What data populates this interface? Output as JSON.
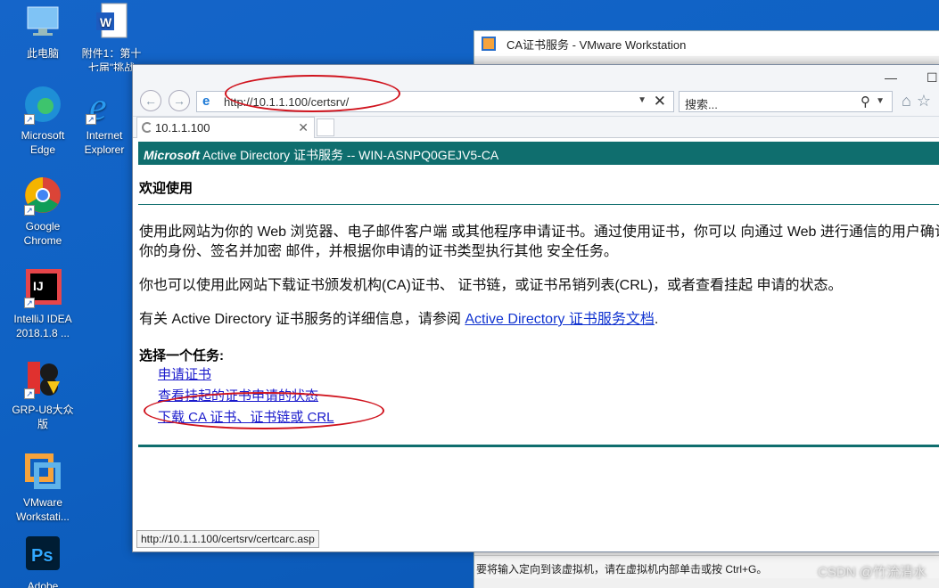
{
  "desktop": {
    "icons": [
      {
        "label": "此电脑"
      },
      {
        "label": "附件1：第十七届\"挑战"
      },
      {
        "label": "Microsoft Edge"
      },
      {
        "label": "Internet Explorer"
      },
      {
        "label": "Google Chrome"
      },
      {
        "label": "IntelliJ IDEA 2018.1.8 ..."
      },
      {
        "label": "GRP-U8大众版"
      },
      {
        "label": "VMware Workstati..."
      },
      {
        "label": "Adobe"
      }
    ]
  },
  "vmware": {
    "title": "CA证书服务 - VMware Workstation",
    "status": "要将输入定向到该虚拟机，请在虚拟机内部单击或按 Ctrl+G。"
  },
  "browser": {
    "address": "http://10.1.1.100/certsrv/",
    "search_placeholder": "搜索...",
    "tab_title": "10.1.1.100",
    "status_url": "http://10.1.1.100/certsrv/certcarc.asp"
  },
  "page": {
    "banner_ms": "Microsoft",
    "banner_rest": " Active Directory 证书服务  --  WIN-ASNPQ0GEJV5-CA",
    "welcome": "欢迎使用",
    "para1_line1": "使用此网站为你的 Web 浏览器、电子邮件客户端 或其他程序申请证书。通过使用证书，你可以 向通过 Web 进行通信的用户确认",
    "para1_line2": "你的身份、签名并加密 邮件，并根据你申请的证书类型执行其他 安全任务。",
    "para2": "你也可以使用此网站下载证书颁发机构(CA)证书、 证书链，或证书吊销列表(CRL)，或者查看挂起 申请的状态。",
    "para3_prefix": "有关 Active Directory 证书服务的详细信息，请参阅 ",
    "para3_link": "Active Directory 证书服务文档",
    "para3_suffix": ".",
    "task_heading": "选择一个任务:",
    "tasks": [
      {
        "label": "申请证书"
      },
      {
        "label": "查看挂起的证书申请的状态"
      },
      {
        "label": "下载 CA 证书、证书链或 CRL"
      }
    ]
  },
  "watermark": "CSDN @竹流清水"
}
